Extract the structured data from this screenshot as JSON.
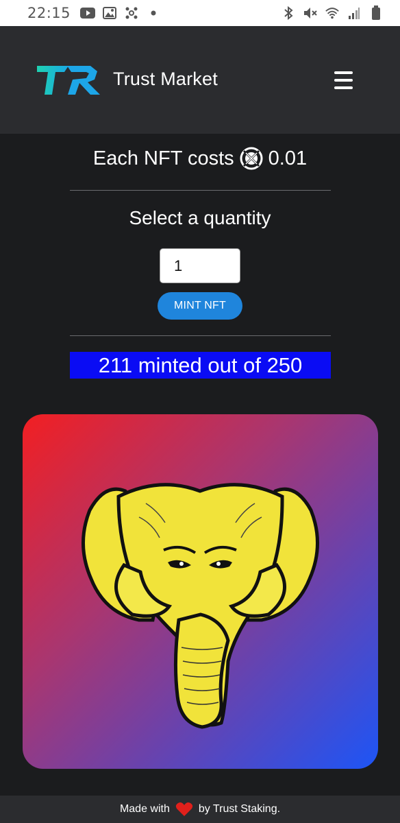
{
  "status_bar": {
    "time": "22:15"
  },
  "header": {
    "brand": "Trust Market",
    "logo_text": "TR"
  },
  "main": {
    "price_prefix": "Each NFT costs",
    "price_value": "0.01",
    "select_label": "Select a quantity",
    "quantity_value": "1",
    "mint_button": "MINT NFT",
    "minted_text": "211 minted out of 250"
  },
  "footer": {
    "prefix": "Made with",
    "suffix": "by Trust Staking."
  },
  "colors": {
    "header_bg": "#2b2c2f",
    "page_bg": "#1b1c1e",
    "mint_button": "#1f85dc",
    "minted_banner": "#0a0cf4",
    "card_gradient_start": "#f21f22",
    "card_gradient_end": "#1d55f6",
    "elephant": "#f1e33a",
    "heart": "#e0201b"
  }
}
